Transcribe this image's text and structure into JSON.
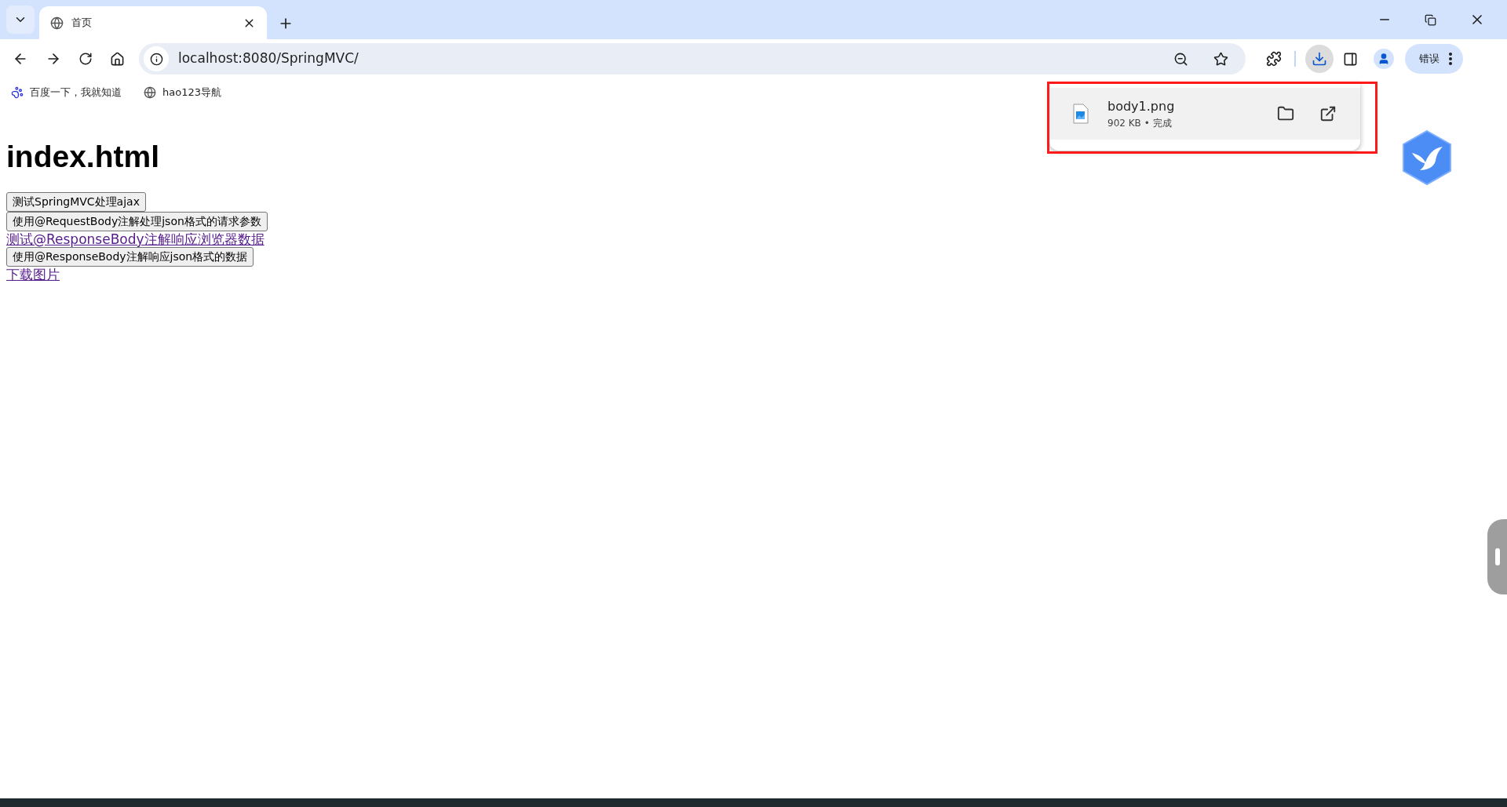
{
  "tabs": [
    {
      "title": "首页",
      "selected": true
    }
  ],
  "address": "localhost:8080/SpringMVC/",
  "profile_button": "错误",
  "bookmarks": [
    {
      "label": "百度一下，我就知道",
      "kind": "baidu"
    },
    {
      "label": "hao123导航",
      "kind": "globe"
    }
  ],
  "download": {
    "file": "body1.png",
    "meta": "902 KB • 完成"
  },
  "page": {
    "heading": "index.html",
    "items": [
      {
        "kind": "button",
        "label": "测试SpringMVC处理ajax"
      },
      {
        "kind": "button",
        "label": "使用@RequestBody注解处理json格式的请求参数"
      },
      {
        "kind": "link",
        "label": "测试@ResponseBody注解响应浏览器数据"
      },
      {
        "kind": "button",
        "label": "使用@ResponseBody注解响应json格式的数据"
      },
      {
        "kind": "link",
        "label": "下载图片"
      }
    ]
  }
}
